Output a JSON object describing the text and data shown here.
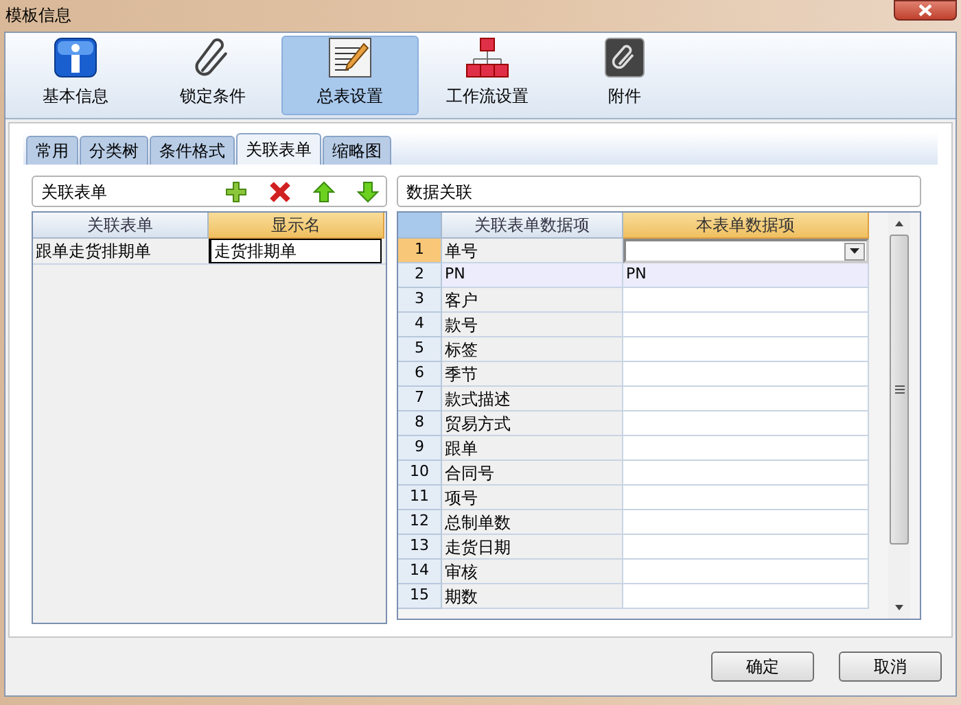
{
  "window": {
    "title": "模板信息"
  },
  "toolbar": [
    {
      "label": "基本信息",
      "kind": "info",
      "selected": false
    },
    {
      "label": "锁定条件",
      "kind": "clip",
      "selected": false
    },
    {
      "label": "总表设置",
      "kind": "notepad",
      "selected": true
    },
    {
      "label": "工作流设置",
      "kind": "hierarchy",
      "selected": false
    },
    {
      "label": "附件",
      "kind": "attach",
      "selected": false
    }
  ],
  "tabs": [
    {
      "label": "常用",
      "selected": false
    },
    {
      "label": "分类树",
      "selected": false
    },
    {
      "label": "条件格式",
      "selected": false
    },
    {
      "label": "关联表单",
      "selected": true
    },
    {
      "label": "缩略图",
      "selected": false
    }
  ],
  "left_panel": {
    "title": "关联表单",
    "columns": [
      {
        "label": "关联表单",
        "selected": false
      },
      {
        "label": "显示名",
        "selected": true
      }
    ],
    "rows": [
      {
        "cells": [
          "跟单走货排期单",
          "走货排期单"
        ],
        "editing": true
      }
    ]
  },
  "right_panel": {
    "title": "数据关联",
    "columns": [
      {
        "label": "关联表单数据项",
        "selected": false
      },
      {
        "label": "本表单数据项",
        "selected": true
      }
    ],
    "rows": [
      {
        "no": "1",
        "source": "单号",
        "kind": "dropdown",
        "selected": true,
        "highlighted": false
      },
      {
        "no": "2",
        "source": "PN",
        "target": "PN",
        "kind": "text",
        "selected": false,
        "highlighted": true
      },
      {
        "no": "3",
        "source": "客户",
        "kind": "text",
        "selected": false,
        "highlighted": false
      },
      {
        "no": "4",
        "source": "款号",
        "kind": "text",
        "selected": false,
        "highlighted": false
      },
      {
        "no": "5",
        "source": "标签",
        "kind": "text",
        "selected": false,
        "highlighted": false
      },
      {
        "no": "6",
        "source": "季节",
        "kind": "text",
        "selected": false,
        "highlighted": false
      },
      {
        "no": "7",
        "source": "款式描述",
        "kind": "text",
        "selected": false,
        "highlighted": false
      },
      {
        "no": "8",
        "source": "贸易方式",
        "kind": "text",
        "selected": false,
        "highlighted": false
      },
      {
        "no": "9",
        "source": "跟单",
        "kind": "text",
        "selected": false,
        "highlighted": false
      },
      {
        "no": "10",
        "source": "合同号",
        "kind": "text",
        "selected": false,
        "highlighted": false
      },
      {
        "no": "11",
        "source": "项号",
        "kind": "text",
        "selected": false,
        "highlighted": false
      },
      {
        "no": "12",
        "source": "总制单数",
        "kind": "text",
        "selected": false,
        "highlighted": false
      },
      {
        "no": "13",
        "source": "走货日期",
        "kind": "text",
        "selected": false,
        "highlighted": false
      },
      {
        "no": "14",
        "source": "审核",
        "kind": "text",
        "selected": false,
        "highlighted": false
      },
      {
        "no": "15",
        "source": "期数",
        "kind": "text",
        "selected": false,
        "highlighted": false
      }
    ]
  },
  "buttons": [
    "确定",
    "取消"
  ]
}
